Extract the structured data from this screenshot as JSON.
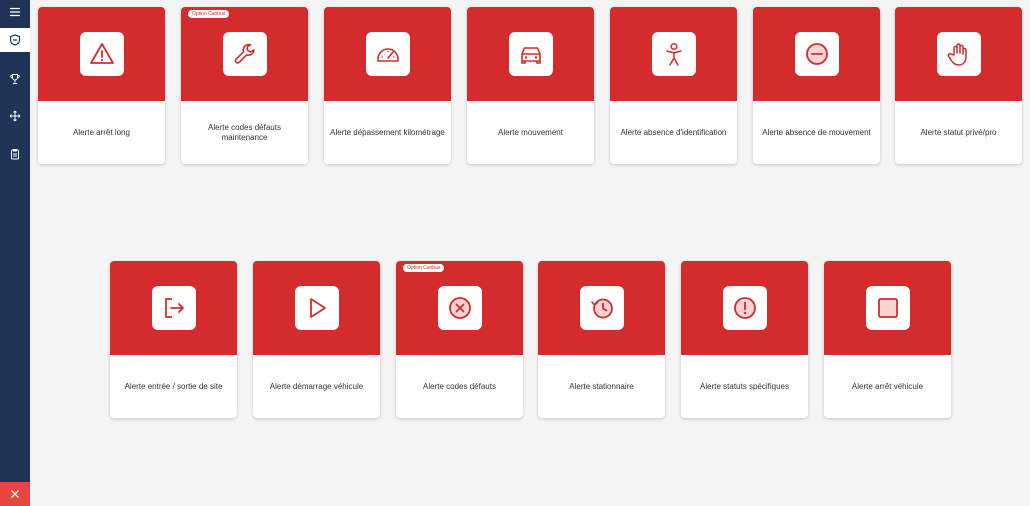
{
  "colors": {
    "sidebar": "#1f3457",
    "card_top": "#d42c2c",
    "close": "#e8473f",
    "background": "#f4f4f4"
  },
  "sidebar": {
    "items": [
      {
        "icon": "menu-icon"
      },
      {
        "icon": "shield-icon",
        "active": true
      },
      {
        "icon": "trophy-icon"
      },
      {
        "icon": "move-icon"
      },
      {
        "icon": "clipboard-icon"
      }
    ],
    "close_icon": "close-icon"
  },
  "badge_label": "Option Canbus",
  "cards": [
    {
      "label": "Alerte arrêt long",
      "icon": "warning-icon"
    },
    {
      "label": "Alerte codes défauts maintenance",
      "icon": "wrench-icon",
      "badge": "Option Canbus"
    },
    {
      "label": "Alerte dépassement kilométrage",
      "icon": "speedometer-icon"
    },
    {
      "label": "Alerte mouvement",
      "icon": "car-icon"
    },
    {
      "label": "Alerte absence d'identification",
      "icon": "person-icon"
    },
    {
      "label": "Alerte absence de mouvement",
      "icon": "minus-circle-icon"
    },
    {
      "label": "Alerte statut privé/pro",
      "icon": "hand-icon"
    },
    {
      "label": "Alerte entrée / sortie de site",
      "icon": "exit-icon"
    },
    {
      "label": "Alerte démarrage véhicule",
      "icon": "play-icon"
    },
    {
      "label": "Alerte codes défauts",
      "icon": "x-circle-icon",
      "badge": "Option Canbus"
    },
    {
      "label": "Alerte stationnaire",
      "icon": "history-icon"
    },
    {
      "label": "Alerte statuts spécifiques",
      "icon": "exclamation-circle-icon"
    },
    {
      "label": "Alerte arrêt véhicule",
      "icon": "stop-icon"
    }
  ]
}
